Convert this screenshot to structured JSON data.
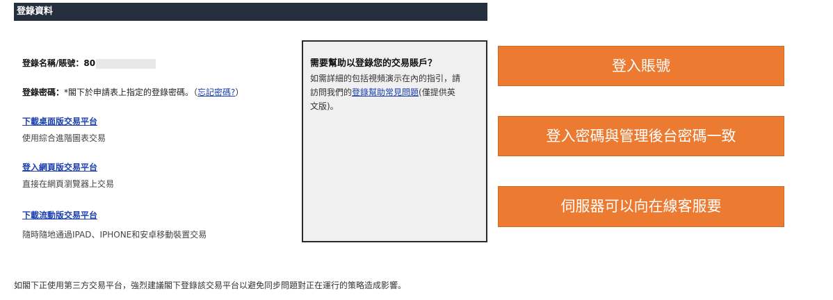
{
  "header": {
    "title": "登錄資料"
  },
  "login": {
    "account_label": "登錄名稱/賬號：",
    "account_value": "80",
    "password_label": "登錄密碼：",
    "password_note": "*閣下於申請表上指定的登錄密碼。（",
    "forgot_link": "忘記密碼?",
    "password_close": "）"
  },
  "platforms": [
    {
      "link": "下載桌面版交易平台",
      "desc": "使用綜合進階圖表交易"
    },
    {
      "link": "登入網頁版交易平台",
      "desc": "直接在網頁瀏覽器上交易"
    },
    {
      "link": "下載流動版交易平台",
      "desc": "隨時隨地通過IPAD、IPHONE和安卓移動裝置交易"
    }
  ],
  "help": {
    "title": "需要幫助以登錄您的交易賬戶？",
    "line1": "如需詳細的包括視頻演示在內的指引，請",
    "line2_prefix": "訪問我們的",
    "faq_link": "登錄幫助常見問題",
    "line2_suffix": "(僅提供英",
    "line3": "文版)。"
  },
  "callouts": [
    {
      "text": "登入賬號",
      "color": "#ec7a31"
    },
    {
      "text": "登入密碼與管理後台密碼一致",
      "color": "#ec7a31"
    },
    {
      "text": "伺服器可以向在線客服要",
      "color": "#ec7a31"
    }
  ],
  "footer": {
    "text": "如閣下正使用第三方交易平台，強烈建議閣下登錄該交易平台以避免同步問題對正在運行的策略造成影響。"
  }
}
